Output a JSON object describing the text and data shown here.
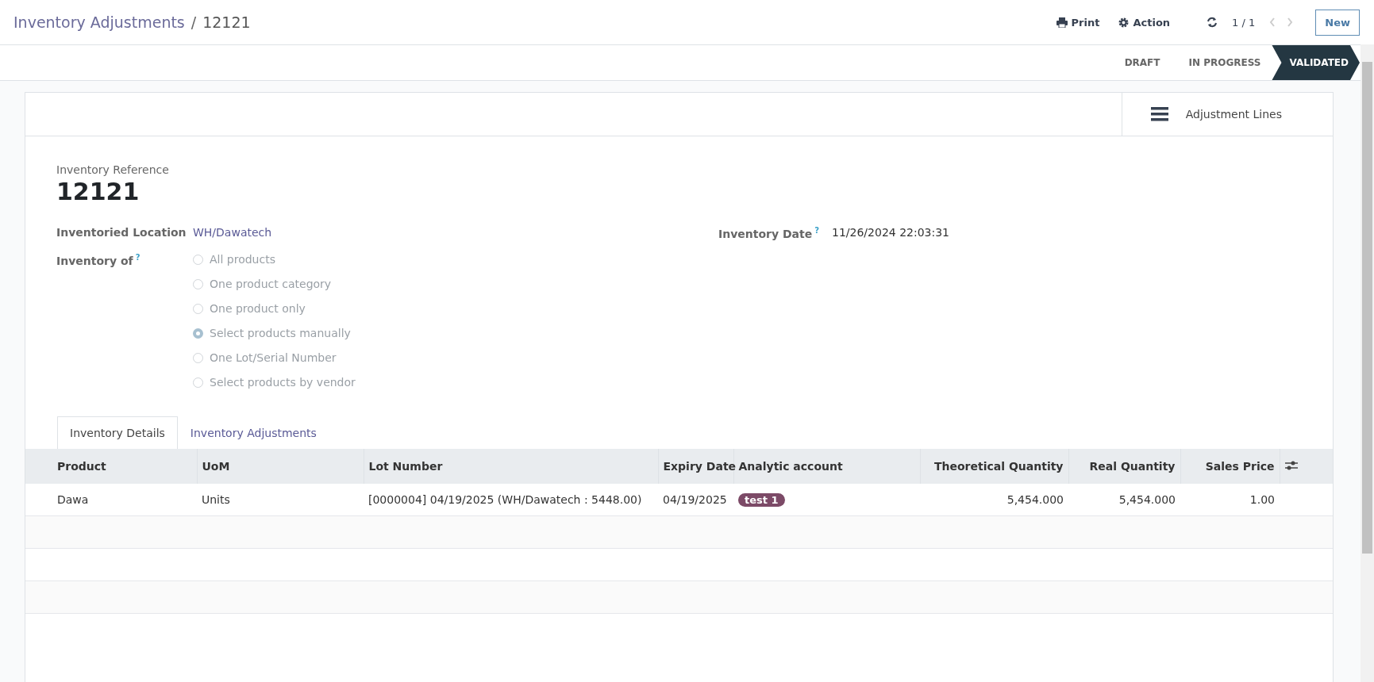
{
  "breadcrumb": {
    "parent": "Inventory Adjustments",
    "separator": "/",
    "current": "12121"
  },
  "toolbar": {
    "print": "Print",
    "action": "Action",
    "pager": "1 / 1",
    "new_button": "New"
  },
  "status_bar": [
    {
      "label": "DRAFT",
      "selected": false
    },
    {
      "label": "IN PROGRESS",
      "selected": false
    },
    {
      "label": "VALIDATED",
      "selected": true
    }
  ],
  "button_box": [
    {
      "label": "Adjustment Lines"
    }
  ],
  "form": {
    "reference_label": "Inventory Reference",
    "reference": "12121",
    "location": {
      "label": "Inventoried Location",
      "value": "WH/Dawatech"
    },
    "date": {
      "label": "Inventory Date",
      "help": "?",
      "value": "11/26/2024 22:03:31"
    },
    "inventory_of": {
      "label": "Inventory of",
      "help": "?",
      "options": [
        {
          "label": "All products",
          "selected": false,
          "disabled": true
        },
        {
          "label": "One product category",
          "selected": false,
          "disabled": true
        },
        {
          "label": "One product only",
          "selected": false,
          "disabled": true
        },
        {
          "label": "Select products manually",
          "selected": true,
          "disabled": true
        },
        {
          "label": "One Lot/Serial Number",
          "selected": false,
          "disabled": true
        },
        {
          "label": "Select products by vendor",
          "selected": false,
          "disabled": true
        }
      ]
    }
  },
  "tabs": [
    {
      "label": "Inventory Details",
      "selected": true
    },
    {
      "label": "Inventory Adjustments",
      "selected": false
    }
  ],
  "table": {
    "columns": [
      {
        "label": "Product",
        "kind": "text"
      },
      {
        "label": "UoM",
        "kind": "text"
      },
      {
        "label": "Lot Number",
        "kind": "text"
      },
      {
        "label": "Expiry Date",
        "kind": "text"
      },
      {
        "label": "Analytic account",
        "kind": "tags"
      },
      {
        "label": "Theoretical Quantity",
        "kind": "number"
      },
      {
        "label": "Real Quantity",
        "kind": "number"
      },
      {
        "label": "Sales Price",
        "kind": "number"
      }
    ],
    "rows": [
      {
        "cells": [
          "Dawa",
          "Units",
          "[0000004] 04/19/2025 (WH/Dawatech : 5448.00)",
          "04/19/2025",
          [
            {
              "label": "test 1",
              "color": "#7c4a67"
            }
          ],
          "5,454.000",
          "5,454.000",
          "1.00"
        ]
      }
    ]
  }
}
